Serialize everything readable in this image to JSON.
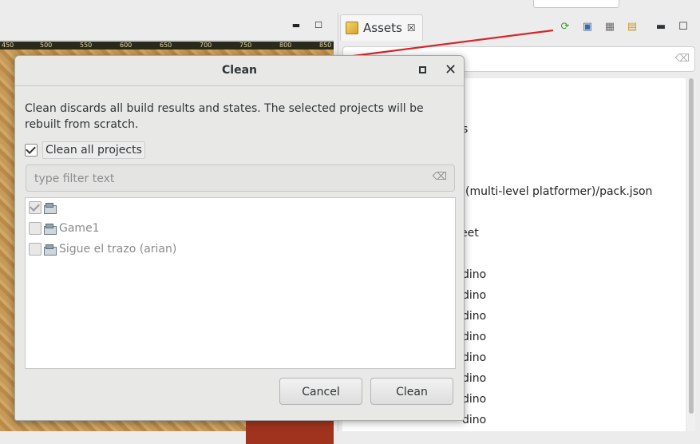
{
  "dialog": {
    "title": "Clean",
    "description": "Clean discards all build results and states. The selected projects will be rebuilt from scratch.",
    "clean_all_label": "Clean all projects",
    "clean_all_checked": true,
    "filter_placeholder": "type filter text",
    "projects": [
      {
        "name": "",
        "checked": true
      },
      {
        "name": "Game1",
        "checked": false
      },
      {
        "name": "Sigue el trazo (arian)",
        "checked": false
      }
    ],
    "cancel_label": "Cancel",
    "clean_label": "Clean"
  },
  "assets": {
    "tab_label": "Assets",
    "tree_items": [
      "s",
      "o (multi-level platformer)/pack.json",
      "eet",
      "dino",
      "dino",
      "dino",
      "dino",
      "dino",
      "dino",
      "dino",
      "dino"
    ]
  },
  "scene": {
    "ruler_ticks": [
      "450",
      "500",
      "550",
      "600",
      "650",
      "700",
      "750",
      "800",
      "850"
    ]
  },
  "colors": {
    "arrow": "#d9262b",
    "dialog_bg": "#e8e8e7"
  }
}
